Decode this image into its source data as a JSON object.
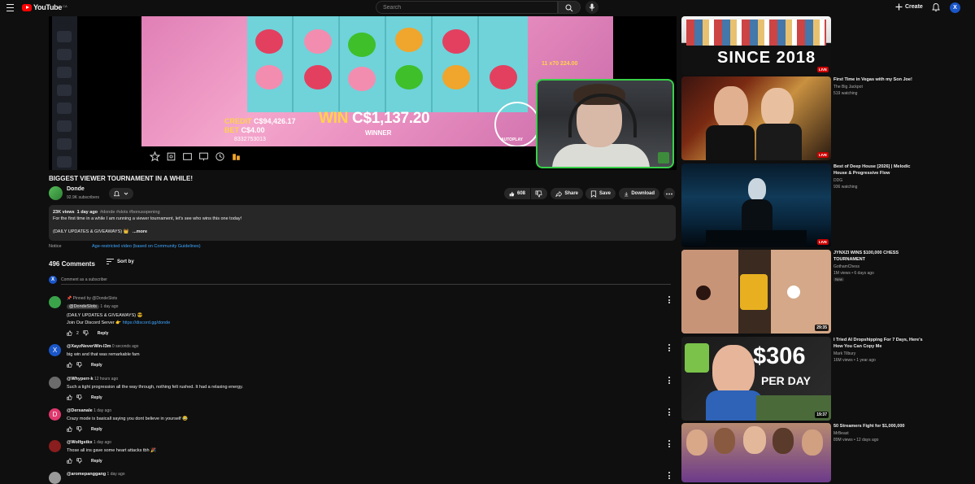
{
  "header": {
    "logo_text": "YouTube",
    "logo_country": "CA",
    "search_placeholder": "Search",
    "create_label": "Create",
    "avatar_letter": "X"
  },
  "player": {
    "game_credit_label": "CREDIT",
    "game_credit_value": "C$94,426.17",
    "game_bet_label": "BET",
    "game_bet_value": "C$4.00",
    "game_win_label": "WIN",
    "game_win_value": "C$1,137.20",
    "game_winner_label": "WINNER",
    "game_mult_label": "11 x70 224.00",
    "game_round_id": "8332753013",
    "autoplay_label": "AUTOPLAY"
  },
  "video": {
    "title": "BIGGEST VIEWER TOURNAMENT IN A WHILE!",
    "channel_name": "Donde",
    "subscribers": "92.9K subscribers",
    "likes": "608",
    "share_label": "Share",
    "save_label": "Save",
    "download_label": "Download",
    "description": {
      "views": "23K views",
      "age": "1 day ago",
      "tags": "#donde #slots #bonusopening",
      "line1": "For the first time in a while I am running a viewer tournament, let's see who wins this one today!",
      "line2": "(DAILY UPDATES & GIVEAWAYS) 👑",
      "more": "...more"
    },
    "notice_label": "Notice",
    "notice_text": "Age-restricted video (based on Community Guidelines)"
  },
  "comments": {
    "count_label": "496 Comments",
    "sort_label": "Sort by",
    "add_placeholder": "Comment as a subscriber",
    "my_avatar_letter": "X",
    "reply_label": "Reply",
    "pinned_label": "Pinned by @DondeSlots",
    "items": [
      {
        "handle": "@DondeSlots",
        "time": "1 day ago",
        "lines": [
          "(DAILY UPDATES & GIVEAWAYS) 😎"
        ],
        "link_prefix": "Join Our Discord Server 👉",
        "link": "https://discord.gg/donde",
        "likes": "2",
        "avatar_color": "#3aa34a",
        "avatar_letter": ""
      },
      {
        "handle": "@XayzNeverWin-l3m",
        "time": "0 seconds ago",
        "lines": [
          "big win and that was remarkable fam"
        ],
        "likes": "",
        "avatar_color": "#1a56c8",
        "avatar_letter": "X"
      },
      {
        "handle": "@Whyperr-k",
        "time": "12 hours ago",
        "lines": [
          "Such a tight progression all the way through, nothing felt rushed. It had a relaxing energy."
        ],
        "likes": "",
        "avatar_color": "#6b6b6b",
        "avatar_letter": ""
      },
      {
        "handle": "@Dersanale",
        "time": "1 day ago",
        "lines": [
          "Crazy mode is basicall saying you dont believe in yourself 😂"
        ],
        "likes": "",
        "avatar_color": "#e0386e",
        "avatar_letter": "D"
      },
      {
        "handle": "@Wolfgstkx",
        "time": "1 day ago",
        "lines": [
          "Those all ins gave some heart attacks tbh 🎉"
        ],
        "likes": "",
        "avatar_color": "#8a1d1d",
        "avatar_letter": ""
      },
      {
        "handle": "@aromepanggang",
        "time": "1 day ago",
        "lines": [
          ""
        ],
        "likes": "",
        "avatar_color": "#9a9a9a",
        "avatar_letter": ""
      }
    ]
  },
  "recommendations": [
    {
      "title": "",
      "channel": "",
      "meta": "",
      "badge": "LIVE",
      "thumb_text": "SINCE 2018"
    },
    {
      "title": "First Time in Vegas with my Son Joe!",
      "channel": "The Big Jackpot",
      "meta": "519 watching",
      "badge": "LIVE",
      "thumb_text": ""
    },
    {
      "title": "Best of Deep House [2026] | Melodic House & Progressive Flow",
      "channel": "DDG",
      "meta": "936 watching",
      "badge": "LIVE",
      "thumb_text": ""
    },
    {
      "title": "JYNXZI WINS $100,000 CHESS TOURNAMENT",
      "channel": "GothamChess",
      "meta": "1M views • 6 days ago",
      "new": "New",
      "badge": "29:35",
      "thumb_text": ""
    },
    {
      "title": "I Tried AI Dropshipping For 7 Days, Here's How You Can Copy Me",
      "channel": "Mark Tilbury",
      "meta": "16M views • 1 year ago",
      "badge": "19:37",
      "thumb_text": "$306",
      "thumb_text2": "PER DAY"
    },
    {
      "title": "50 Streamers Fight for $1,000,000",
      "channel": "MrBeast",
      "meta": "89M views • 12 days ago",
      "badge": "",
      "thumb_text": ""
    }
  ],
  "colors": {
    "background": "#0f0f0f",
    "surface": "#272727",
    "link": "#3ea6ff",
    "live_red": "#cc0000",
    "webcam_border": "#39d04a"
  }
}
